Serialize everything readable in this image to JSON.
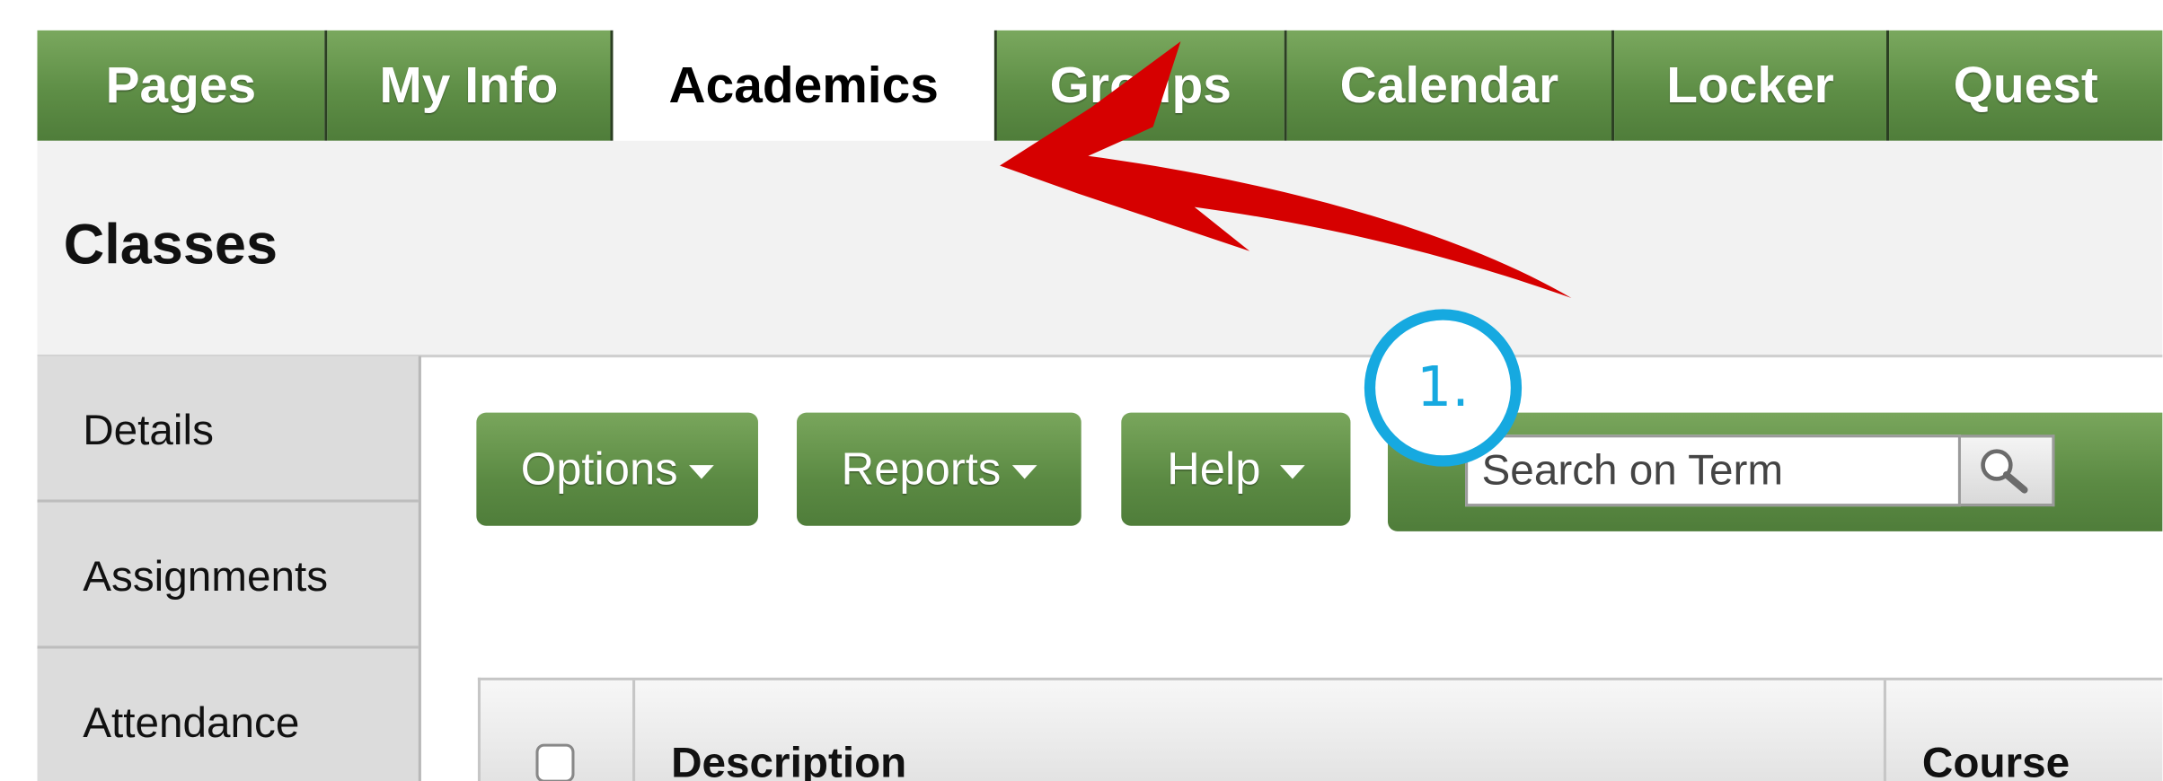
{
  "tabs": [
    {
      "label": "Pages",
      "active": false
    },
    {
      "label": "My Info",
      "active": false
    },
    {
      "label": "Academics",
      "active": true
    },
    {
      "label": "Groups",
      "active": false
    },
    {
      "label": "Calendar",
      "active": false
    },
    {
      "label": "Locker",
      "active": false
    },
    {
      "label": "Quest",
      "active": false
    }
  ],
  "page_title": "Classes",
  "sidebar": {
    "items": [
      {
        "label": "Details"
      },
      {
        "label": "Assignments"
      },
      {
        "label": "Attendance"
      }
    ]
  },
  "toolbar": {
    "options_label": "Options",
    "reports_label": "Reports",
    "help_label": "Help"
  },
  "search": {
    "placeholder": "Search on Term",
    "value": ""
  },
  "table": {
    "columns": [
      "",
      "Description",
      "Course"
    ]
  },
  "annotation": {
    "step_label": "1.",
    "arrow_color": "#d60000",
    "badge_color": "#16a9e0"
  },
  "colors": {
    "tab_green": "#5e8e46",
    "title_bg": "#f2f2f2",
    "sidebar_bg": "#dcdcdc"
  }
}
